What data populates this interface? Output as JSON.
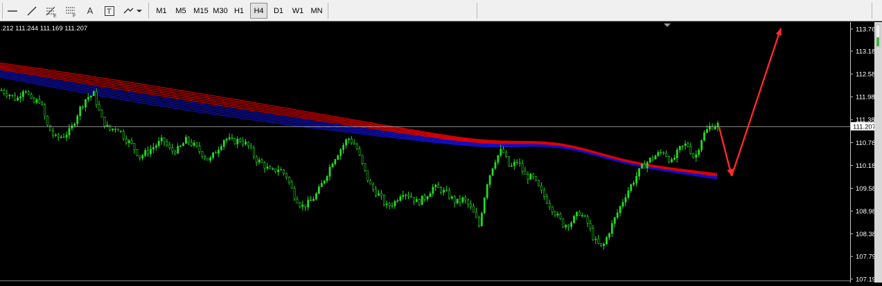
{
  "toolbar": {
    "tools": [
      {
        "name": "horizontal-line-icon"
      },
      {
        "name": "trendline-icon"
      },
      {
        "name": "fibonacci-expansion-icon",
        "glyph_sub": "E"
      },
      {
        "name": "fibonacci-fan-icon",
        "glyph_sub": "F"
      },
      {
        "name": "text-tool-icon",
        "glyph": "A"
      },
      {
        "name": "text-label-icon",
        "glyph": "T"
      },
      {
        "name": "arrows-tool-icon"
      }
    ],
    "timeframes": [
      "M1",
      "M5",
      "M15",
      "M30",
      "H1",
      "H4",
      "D1",
      "W1",
      "MN"
    ],
    "active_timeframe": "H4"
  },
  "ohlc_readout": ".212 111.244 111.169 111.207",
  "chart_data": {
    "type": "candlestick",
    "title": "",
    "price_axis": {
      "ticks": [
        "113.76",
        "113.180",
        "112.580",
        "111.980",
        "111.380",
        "110.780",
        "110.180",
        "109.580",
        "108.980",
        "108.385",
        "107.790",
        "107.195"
      ],
      "range": [
        107.195,
        113.78
      ]
    },
    "current_price": "111.207",
    "colors": {
      "background": "#000000",
      "candles": "#22dd22",
      "ribbon_blue": "#1010c8",
      "ribbon_red": "#e00000",
      "arrows": "#ff2a2a",
      "price_line": "#c0c0c0"
    },
    "close_path": [
      112.15,
      112.05,
      111.9,
      112.25,
      111.8,
      111.9,
      111.2,
      110.9,
      110.95,
      111.1,
      111.6,
      111.95,
      112.05,
      111.4,
      111.1,
      111.2,
      110.9,
      110.7,
      110.4,
      110.55,
      110.7,
      110.85,
      110.55,
      110.6,
      110.85,
      110.7,
      110.5,
      110.3,
      110.6,
      110.9,
      110.8,
      110.85,
      110.7,
      110.35,
      110.2,
      110.0,
      110.1,
      109.9,
      109.4,
      109.1,
      109.2,
      109.45,
      109.85,
      110.3,
      110.6,
      110.9,
      110.7,
      110.1,
      109.6,
      109.4,
      109.1,
      109.2,
      109.5,
      109.4,
      109.2,
      109.35,
      109.6,
      109.55,
      109.4,
      109.2,
      109.3,
      109.05,
      108.6,
      109.7,
      110.3,
      110.6,
      110.1,
      110.3,
      109.9,
      109.85,
      109.5,
      109.2,
      108.9,
      108.6,
      108.7,
      108.95,
      108.7,
      108.2,
      108.0,
      108.5,
      108.95,
      109.4,
      109.75,
      110.1,
      110.3,
      110.45,
      110.55,
      110.25,
      110.6,
      110.75,
      110.35,
      110.95,
      111.2,
      111.25
    ],
    "ribbon_start": 112.7,
    "ribbon_end": 109.9,
    "annotations": [
      {
        "type": "arrow",
        "from_price": 111.18,
        "to_price": 109.9
      },
      {
        "type": "arrow",
        "from_price": 109.9,
        "to_price": 113.78
      }
    ]
  }
}
